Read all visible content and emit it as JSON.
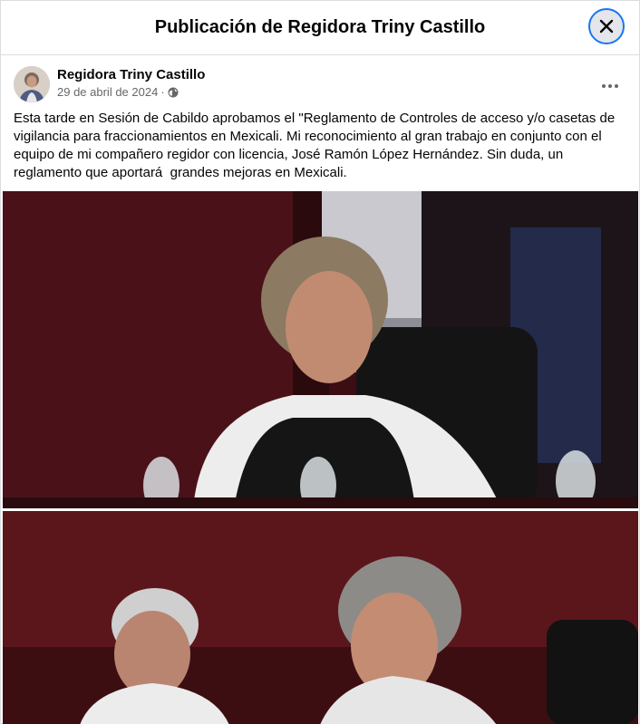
{
  "dialog": {
    "title": "Publicación de Regidora Triny Castillo",
    "close_icon": "close-icon"
  },
  "post": {
    "author": "Regidora Triny Castillo",
    "date": "29 de abril de 2024",
    "separator": "·",
    "privacy_icon": "globe-icon",
    "text": "Esta tarde en Sesión de Cabildo aprobamos el \"Reglamento de Controles de acceso y/o casetas de\nvigilancia para fraccionamientos en Mexicali. Mi reconocimiento al gran trabajo en conjunto con el\nequipo de mi compañero regidor con licencia, José Ramón López Hernández. Sin duda, un\nreglamento que aportará  grandes mejoras en Mexicali."
  },
  "colors": {
    "accent": "#1877f2",
    "secondary_text": "#65676b",
    "photo_background": "#3d0f14"
  }
}
